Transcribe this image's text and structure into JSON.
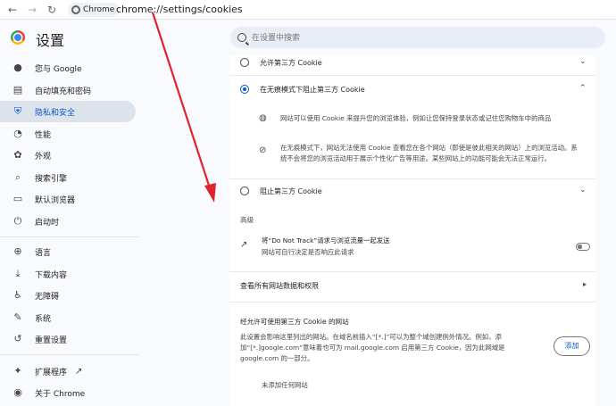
{
  "browser": {
    "chip_label": "Chrome",
    "url": "chrome://settings/cookies"
  },
  "header": {
    "title": "设置",
    "search_placeholder": "在设置中搜索"
  },
  "sidebar": {
    "items": [
      {
        "label": "您与 Google",
        "icon": "person-icon"
      },
      {
        "label": "自动填充和密码",
        "icon": "clipboard-icon"
      },
      {
        "label": "隐私和安全",
        "icon": "shield-icon",
        "active": true
      },
      {
        "label": "性能",
        "icon": "speedometer-icon"
      },
      {
        "label": "外观",
        "icon": "palette-icon"
      },
      {
        "label": "搜索引擎",
        "icon": "search-icon"
      },
      {
        "label": "默认浏览器",
        "icon": "browser-icon"
      },
      {
        "label": "启动时",
        "icon": "power-icon"
      },
      {
        "label": "语言",
        "icon": "globe-icon"
      },
      {
        "label": "下载内容",
        "icon": "download-icon"
      },
      {
        "label": "无障碍",
        "icon": "accessibility-icon"
      },
      {
        "label": "系统",
        "icon": "wrench-icon"
      },
      {
        "label": "重置设置",
        "icon": "reset-icon"
      },
      {
        "label": "扩展程序",
        "icon": "puzzle-icon"
      },
      {
        "label": "关于 Chrome",
        "icon": "chrome-icon"
      }
    ]
  },
  "cookies": {
    "option_allow": "允许第三方 Cookie",
    "option_block_incognito": "在无痕模式下阻止第三方 Cookie",
    "sub_1": "网站可以使用 Cookie 来提升您的浏览体验，例如让您保持登录状态或记住您购物车中的商品",
    "sub_2": "在无痕模式下，网站无法使用 Cookie 查看您在各个网站（即使是彼此相关的网站）上的浏览活动。系统不会将您的浏览活动用于展示个性化广告等用途。某些网站上的功能可能会无法正常运行。",
    "option_block": "阻止第三方 Cookie",
    "advanced_title": "高级",
    "dnt_line1": "将“Do Not Track”请求与浏览流量一起发送",
    "dnt_line2": "网站可自行决定是否响应此请求",
    "dnt_enabled": false,
    "site_data_link": "查看所有网站数据和权限",
    "allowed_title": "经允许可使用第三方 Cookie 的网站",
    "allowed_desc": "此设置会影响这里列出的网站。在域名前插入“[*.]”可以为整个域创建例外情况。例如，添加“[*.]google.com”意味着也可为 mail.google.com 启用第三方 Cookie，因为此网域是 google.com 的一部分。",
    "add_button": "添加",
    "empty_text": "未添加任何网站"
  },
  "colors": {
    "accent": "#0b57d0",
    "annotation_arrow": "#e0242c"
  }
}
